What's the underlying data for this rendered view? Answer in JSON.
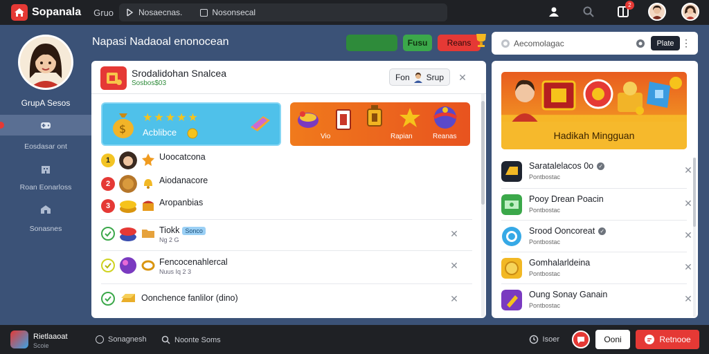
{
  "topbar": {
    "brand": "Sopanala",
    "group": "Gruo",
    "search_item_1": "Nosaecnas.",
    "search_item_2": "Nosonsecal"
  },
  "notifications": {
    "count": "2"
  },
  "sidebar": {
    "profile_name": "GrupA Sesos",
    "items": [
      {
        "label": ""
      },
      {
        "label": "Eosdasar ont"
      },
      {
        "label": "Roan Eonarloss"
      },
      {
        "label": "Sonasnes"
      }
    ]
  },
  "main": {
    "title": "Napasi Nadaoal enonocean",
    "pill_1": "",
    "pill_2": "Fusu",
    "pill_3": "Reans",
    "panel": {
      "title": "Srodalidohan Snalcea",
      "subtitle": "Sosbos$03",
      "chip_left": "Fon",
      "chip_right": "Srup"
    },
    "banner_blue": {
      "label": "Acblibce"
    },
    "banner_orange": {
      "left_label": "Vio",
      "mid_label": "Rapian",
      "right_label": "Reanas"
    },
    "rows": [
      {
        "rank": "1",
        "title": "Uoocatcona",
        "meta": ""
      },
      {
        "rank": "2",
        "title": "Aiodanacore",
        "meta": ""
      },
      {
        "rank": "3",
        "title": "Aropanbias",
        "meta": ""
      },
      {
        "rank": "",
        "title": "Tiokk",
        "tag": "Sonco",
        "meta": "Ng 2 G"
      },
      {
        "rank": "",
        "title": "Fencocenahlercal",
        "meta": "Nuus Iq 2 3"
      },
      {
        "rank": "",
        "title": "Oonchence fanlilor (dino)",
        "meta": ""
      }
    ]
  },
  "right": {
    "search_placeholder": "Aecomolagac",
    "search_button": "Plate",
    "promo_label": "Hadikah Mingguan",
    "items": [
      {
        "title": "Saratalelacos 0o",
        "verified": true,
        "meta": "Pontbostac"
      },
      {
        "title": "Pooy Drean Poacin",
        "verified": false,
        "meta": "Pontbostac"
      },
      {
        "title": "Srood Ooncoreat",
        "verified": true,
        "meta": "Pontbostac"
      },
      {
        "title": "Gomhalarldeina",
        "verified": false,
        "meta": "Pontbostac"
      },
      {
        "title": "Oung Sonay Ganain",
        "verified": false,
        "meta": "Pontbostac"
      }
    ]
  },
  "bottombar": {
    "app_name": "Rietlaaoat",
    "app_sub": "Scoie",
    "item_1": "Sonagnesh",
    "item_2": "Noonte Soms",
    "item_3": "Isoer",
    "btn_white": "Ooni",
    "btn_red": "Retnooe"
  },
  "colors": {
    "accent_red": "#e53935",
    "accent_green": "#3ba84a",
    "bg": "#3b5277",
    "bar": "#1f2125"
  }
}
